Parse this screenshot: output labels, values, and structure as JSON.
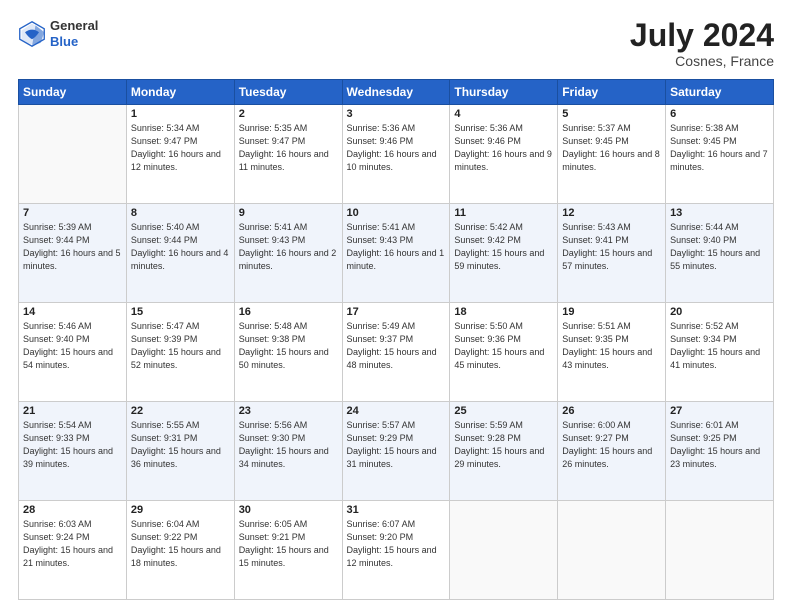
{
  "header": {
    "logo_general": "General",
    "logo_blue": "Blue",
    "month": "July 2024",
    "location": "Cosnes, France"
  },
  "weekdays": [
    "Sunday",
    "Monday",
    "Tuesday",
    "Wednesday",
    "Thursday",
    "Friday",
    "Saturday"
  ],
  "weeks": [
    [
      {
        "day": "",
        "sunrise": "",
        "sunset": "",
        "daylight": ""
      },
      {
        "day": "1",
        "sunrise": "Sunrise: 5:34 AM",
        "sunset": "Sunset: 9:47 PM",
        "daylight": "Daylight: 16 hours and 12 minutes."
      },
      {
        "day": "2",
        "sunrise": "Sunrise: 5:35 AM",
        "sunset": "Sunset: 9:47 PM",
        "daylight": "Daylight: 16 hours and 11 minutes."
      },
      {
        "day": "3",
        "sunrise": "Sunrise: 5:36 AM",
        "sunset": "Sunset: 9:46 PM",
        "daylight": "Daylight: 16 hours and 10 minutes."
      },
      {
        "day": "4",
        "sunrise": "Sunrise: 5:36 AM",
        "sunset": "Sunset: 9:46 PM",
        "daylight": "Daylight: 16 hours and 9 minutes."
      },
      {
        "day": "5",
        "sunrise": "Sunrise: 5:37 AM",
        "sunset": "Sunset: 9:45 PM",
        "daylight": "Daylight: 16 hours and 8 minutes."
      },
      {
        "day": "6",
        "sunrise": "Sunrise: 5:38 AM",
        "sunset": "Sunset: 9:45 PM",
        "daylight": "Daylight: 16 hours and 7 minutes."
      }
    ],
    [
      {
        "day": "7",
        "sunrise": "Sunrise: 5:39 AM",
        "sunset": "Sunset: 9:44 PM",
        "daylight": "Daylight: 16 hours and 5 minutes."
      },
      {
        "day": "8",
        "sunrise": "Sunrise: 5:40 AM",
        "sunset": "Sunset: 9:44 PM",
        "daylight": "Daylight: 16 hours and 4 minutes."
      },
      {
        "day": "9",
        "sunrise": "Sunrise: 5:41 AM",
        "sunset": "Sunset: 9:43 PM",
        "daylight": "Daylight: 16 hours and 2 minutes."
      },
      {
        "day": "10",
        "sunrise": "Sunrise: 5:41 AM",
        "sunset": "Sunset: 9:43 PM",
        "daylight": "Daylight: 16 hours and 1 minute."
      },
      {
        "day": "11",
        "sunrise": "Sunrise: 5:42 AM",
        "sunset": "Sunset: 9:42 PM",
        "daylight": "Daylight: 15 hours and 59 minutes."
      },
      {
        "day": "12",
        "sunrise": "Sunrise: 5:43 AM",
        "sunset": "Sunset: 9:41 PM",
        "daylight": "Daylight: 15 hours and 57 minutes."
      },
      {
        "day": "13",
        "sunrise": "Sunrise: 5:44 AM",
        "sunset": "Sunset: 9:40 PM",
        "daylight": "Daylight: 15 hours and 55 minutes."
      }
    ],
    [
      {
        "day": "14",
        "sunrise": "Sunrise: 5:46 AM",
        "sunset": "Sunset: 9:40 PM",
        "daylight": "Daylight: 15 hours and 54 minutes."
      },
      {
        "day": "15",
        "sunrise": "Sunrise: 5:47 AM",
        "sunset": "Sunset: 9:39 PM",
        "daylight": "Daylight: 15 hours and 52 minutes."
      },
      {
        "day": "16",
        "sunrise": "Sunrise: 5:48 AM",
        "sunset": "Sunset: 9:38 PM",
        "daylight": "Daylight: 15 hours and 50 minutes."
      },
      {
        "day": "17",
        "sunrise": "Sunrise: 5:49 AM",
        "sunset": "Sunset: 9:37 PM",
        "daylight": "Daylight: 15 hours and 48 minutes."
      },
      {
        "day": "18",
        "sunrise": "Sunrise: 5:50 AM",
        "sunset": "Sunset: 9:36 PM",
        "daylight": "Daylight: 15 hours and 45 minutes."
      },
      {
        "day": "19",
        "sunrise": "Sunrise: 5:51 AM",
        "sunset": "Sunset: 9:35 PM",
        "daylight": "Daylight: 15 hours and 43 minutes."
      },
      {
        "day": "20",
        "sunrise": "Sunrise: 5:52 AM",
        "sunset": "Sunset: 9:34 PM",
        "daylight": "Daylight: 15 hours and 41 minutes."
      }
    ],
    [
      {
        "day": "21",
        "sunrise": "Sunrise: 5:54 AM",
        "sunset": "Sunset: 9:33 PM",
        "daylight": "Daylight: 15 hours and 39 minutes."
      },
      {
        "day": "22",
        "sunrise": "Sunrise: 5:55 AM",
        "sunset": "Sunset: 9:31 PM",
        "daylight": "Daylight: 15 hours and 36 minutes."
      },
      {
        "day": "23",
        "sunrise": "Sunrise: 5:56 AM",
        "sunset": "Sunset: 9:30 PM",
        "daylight": "Daylight: 15 hours and 34 minutes."
      },
      {
        "day": "24",
        "sunrise": "Sunrise: 5:57 AM",
        "sunset": "Sunset: 9:29 PM",
        "daylight": "Daylight: 15 hours and 31 minutes."
      },
      {
        "day": "25",
        "sunrise": "Sunrise: 5:59 AM",
        "sunset": "Sunset: 9:28 PM",
        "daylight": "Daylight: 15 hours and 29 minutes."
      },
      {
        "day": "26",
        "sunrise": "Sunrise: 6:00 AM",
        "sunset": "Sunset: 9:27 PM",
        "daylight": "Daylight: 15 hours and 26 minutes."
      },
      {
        "day": "27",
        "sunrise": "Sunrise: 6:01 AM",
        "sunset": "Sunset: 9:25 PM",
        "daylight": "Daylight: 15 hours and 23 minutes."
      }
    ],
    [
      {
        "day": "28",
        "sunrise": "Sunrise: 6:03 AM",
        "sunset": "Sunset: 9:24 PM",
        "daylight": "Daylight: 15 hours and 21 minutes."
      },
      {
        "day": "29",
        "sunrise": "Sunrise: 6:04 AM",
        "sunset": "Sunset: 9:22 PM",
        "daylight": "Daylight: 15 hours and 18 minutes."
      },
      {
        "day": "30",
        "sunrise": "Sunrise: 6:05 AM",
        "sunset": "Sunset: 9:21 PM",
        "daylight": "Daylight: 15 hours and 15 minutes."
      },
      {
        "day": "31",
        "sunrise": "Sunrise: 6:07 AM",
        "sunset": "Sunset: 9:20 PM",
        "daylight": "Daylight: 15 hours and 12 minutes."
      },
      {
        "day": "",
        "sunrise": "",
        "sunset": "",
        "daylight": ""
      },
      {
        "day": "",
        "sunrise": "",
        "sunset": "",
        "daylight": ""
      },
      {
        "day": "",
        "sunrise": "",
        "sunset": "",
        "daylight": ""
      }
    ]
  ]
}
